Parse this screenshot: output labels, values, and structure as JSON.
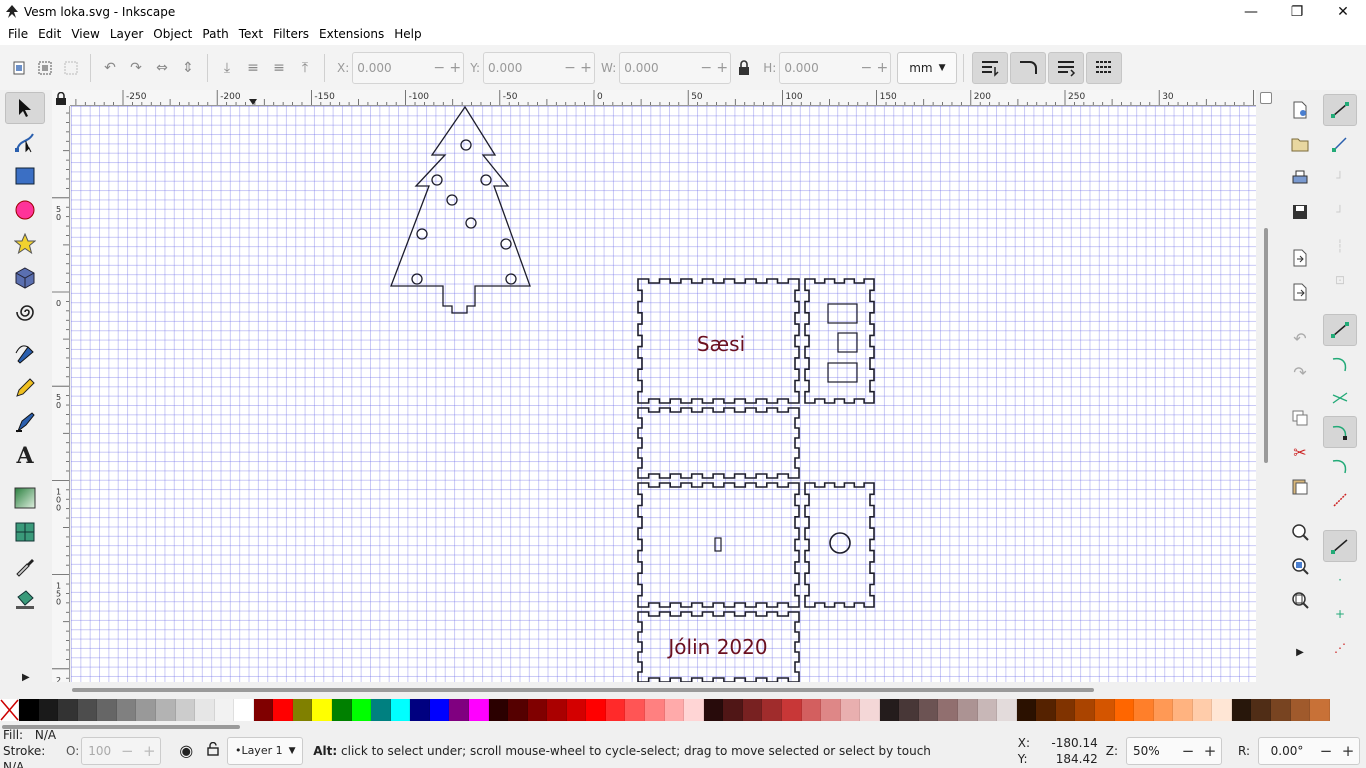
{
  "window": {
    "title": "Vesm loka.svg - Inkscape",
    "minimize": "—",
    "maximize": "❐",
    "close": "✕"
  },
  "menu": [
    "File",
    "Edit",
    "View",
    "Layer",
    "Object",
    "Path",
    "Text",
    "Filters",
    "Extensions",
    "Help"
  ],
  "toolbar": {
    "x_label": "X:",
    "x_value": "0.000",
    "y_label": "Y:",
    "y_value": "0.000",
    "w_label": "W:",
    "w_value": "0.000",
    "h_label": "H:",
    "h_value": "0.000",
    "unit": "mm",
    "spin_minus": "−",
    "spin_plus": "+"
  },
  "ruler": {
    "h_labels": [
      "-250",
      "-200",
      "-150",
      "-100",
      "-50",
      "0",
      "50",
      "100",
      "150",
      "200",
      "250",
      "30"
    ],
    "v_labels": [
      "5\n0",
      "0",
      "5\n0",
      "1\n0\n0",
      "1\n5\n0",
      "2\n0"
    ]
  },
  "canvas_text": {
    "saesi": "Sæsi",
    "jolin": "Jólin 2020"
  },
  "palette": {
    "colors": [
      "#000000",
      "#1a1a1a",
      "#333333",
      "#4d4d4d",
      "#666666",
      "#808080",
      "#999999",
      "#b3b3b3",
      "#cccccc",
      "#e6e6e6",
      "#f2f2f2",
      "#ffffff",
      "#800000",
      "#ff0000",
      "#808000",
      "#ffff00",
      "#008000",
      "#00ff00",
      "#008080",
      "#00ffff",
      "#000080",
      "#0000ff",
      "#800080",
      "#ff00ff",
      "#2b0000",
      "#550000",
      "#800000",
      "#aa0000",
      "#d40000",
      "#ff0000",
      "#ff2a2a",
      "#ff5555",
      "#ff8080",
      "#ffaaaa",
      "#ffd5d5",
      "#280b0b",
      "#501616",
      "#782121",
      "#a02c2c",
      "#c83737",
      "#d35f5f",
      "#de8787",
      "#e9afaf",
      "#f4d7d7",
      "#241c1c",
      "#483737",
      "#6c5353",
      "#916f6f",
      "#ac9393",
      "#c8b7b7",
      "#e3dbdb",
      "#2b1100",
      "#552200",
      "#803300",
      "#aa4400",
      "#d45500",
      "#ff6600",
      "#ff7f2a",
      "#ff9955",
      "#ffb380",
      "#ffccaa",
      "#ffe6d5",
      "#28170b",
      "#502d16",
      "#784421",
      "#a05a2c",
      "#c87137"
    ]
  },
  "status": {
    "fill_label": "Fill:",
    "fill_value": "N/A",
    "stroke_label": "Stroke:",
    "stroke_value": "N/A",
    "opacity_label": "O:",
    "opacity_value": "100",
    "layer": "•Layer 1",
    "message_bold": "Alt:",
    "message": "click to select under; scroll mouse-wheel to cycle-select; drag to move selected or select by touch",
    "x_label": "X:",
    "x_value": "-180.14",
    "y_label": "Y:",
    "y_value": "184.42",
    "zoom_label": "Z:",
    "zoom_value": "50%",
    "rotate_label": "R:",
    "rotate_value": "0.00°"
  }
}
